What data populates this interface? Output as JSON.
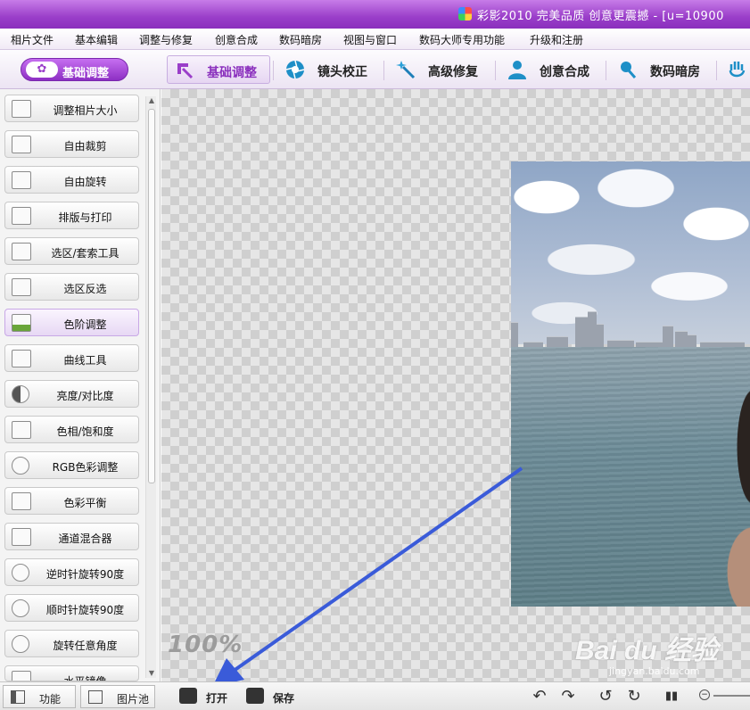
{
  "titlebar": {
    "title": "彩影2010 完美品质 创意更震撼 - [u=10900"
  },
  "menubar": {
    "items": [
      "相片文件",
      "基本编辑",
      "调整与修复",
      "创意合成",
      "数码暗房",
      "视图与窗口",
      "数码大师专用功能",
      "升级和注册"
    ]
  },
  "toolbar": {
    "pill_label": "基础调整",
    "tabs": [
      {
        "label": "基础调整",
        "icon": "arrow-corner-icon"
      },
      {
        "label": "镜头校正",
        "icon": "aperture-icon"
      },
      {
        "label": "高级修复",
        "icon": "magic-wand-icon"
      },
      {
        "label": "创意合成",
        "icon": "person-icon"
      },
      {
        "label": "数码暗房",
        "icon": "microphone-icon"
      }
    ],
    "accent_color": "#9a3ec9"
  },
  "leftpanel": {
    "buttons": [
      "调整相片大小",
      "自由裁剪",
      "自由旋转",
      "排版与打印",
      "选区/套索工具",
      "选区反选",
      "色阶调整",
      "曲线工具",
      "亮度/对比度",
      "色相/饱和度",
      "RGB色彩调整",
      "色彩平衡",
      "通道混合器",
      "逆时针旋转90度",
      "顺时针旋转90度",
      "旋转任意角度",
      "水平镜像"
    ],
    "active_index": 6
  },
  "canvas": {
    "zoom": "100%",
    "watermark": "Bai du 经验",
    "watermark_sub": "jingyan.baidu.com"
  },
  "bottombar": {
    "tab_function": "功能",
    "tab_photo_pool": "图片池",
    "open_label": "打开",
    "save_label": "保存"
  }
}
